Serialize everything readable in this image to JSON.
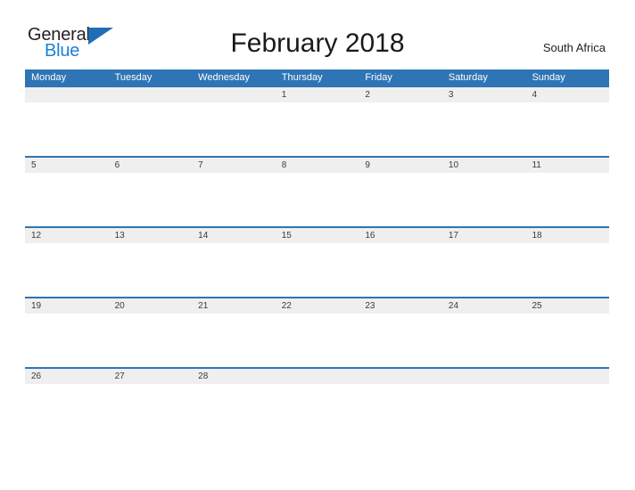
{
  "header": {
    "logo": {
      "text_primary": "General",
      "text_secondary": "Blue",
      "flag_icon": "triangle-flag-icon",
      "color_primary": "#231f20",
      "color_secondary": "#1b7fd4",
      "color_flag": "#1f6eb5"
    },
    "title": "February 2018",
    "locale": "South Africa"
  },
  "calendar": {
    "accent_color": "#2f74b5",
    "date_band_color": "#efefef",
    "weekdays": [
      "Monday",
      "Tuesday",
      "Wednesday",
      "Thursday",
      "Friday",
      "Saturday",
      "Sunday"
    ],
    "weeks": [
      [
        "",
        "",
        "",
        "1",
        "2",
        "3",
        "4"
      ],
      [
        "5",
        "6",
        "7",
        "8",
        "9",
        "10",
        "11"
      ],
      [
        "12",
        "13",
        "14",
        "15",
        "16",
        "17",
        "18"
      ],
      [
        "19",
        "20",
        "21",
        "22",
        "23",
        "24",
        "25"
      ],
      [
        "26",
        "27",
        "28",
        "",
        "",
        "",
        ""
      ]
    ]
  }
}
